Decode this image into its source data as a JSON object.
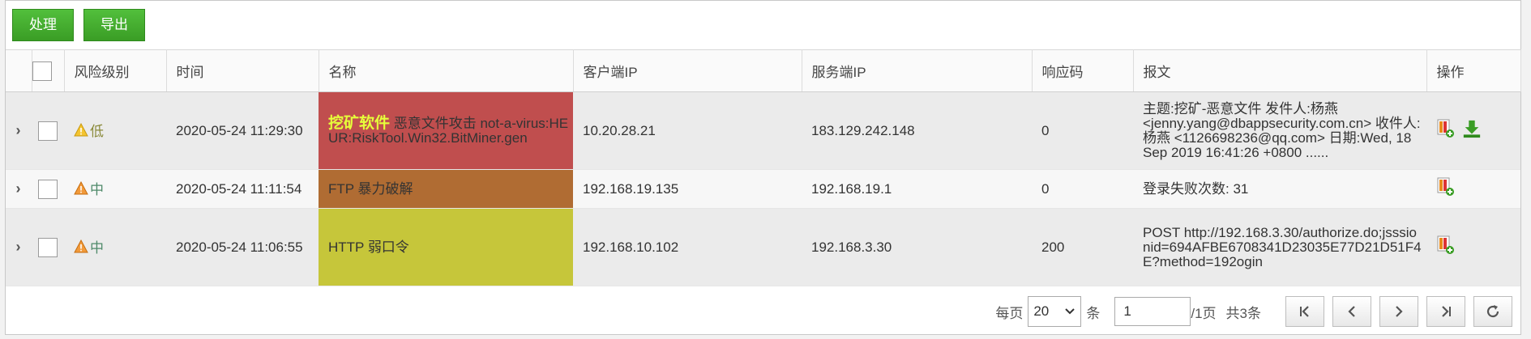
{
  "toolbar": {
    "process_label": "处理",
    "export_label": "导出"
  },
  "columns": {
    "risk": "风险级别",
    "time": "时间",
    "name": "名称",
    "client_ip": "客户端IP",
    "server_ip": "服务端IP",
    "code": "响应码",
    "message": "报文",
    "action": "操作"
  },
  "rows": [
    {
      "risk": "低",
      "time": "2020-05-24 11:29:30",
      "name_tag": "挖矿软件",
      "name_text": " 恶意文件攻击 ",
      "name_dark": "not-a-virus:HEUR:RiskTool.Win32.BitMiner.gen",
      "client_ip": "10.20.28.21",
      "server_ip": "183.129.242.148",
      "code": "0",
      "message": "主题:挖矿-恶意文件 发件人:杨燕 <jenny.yang@dbappsecurity.com.cn> 收件人:杨燕 <1126698236@qq.com> 日期:Wed, 18 Sep 2019 16:41:26 +0800 ......"
    },
    {
      "risk": "中",
      "time": "2020-05-24 11:11:54",
      "name_dark": "FTP ",
      "name_text": "暴力破解",
      "client_ip": "192.168.19.135",
      "server_ip": "192.168.19.1",
      "code": "0",
      "message": "登录失败次数: 31"
    },
    {
      "risk": "中",
      "time": "2020-05-24 11:06:55",
      "name_dark": "HTTP ",
      "name_text": "弱口令",
      "client_ip": "192.168.10.102",
      "server_ip": "192.168.3.30",
      "code": "200",
      "message": "POST http://192.168.3.30/authorize.do;jsssionid=694AFBE6708341D23035E77D21D51F4E?method=192ogin"
    }
  ],
  "pager": {
    "per_page_label": "每页",
    "per_page_value": "20",
    "unit_label": "条",
    "page_input": "1",
    "page_total": "/1页",
    "count_label": "共3条"
  },
  "icon_colors": {
    "green": "#3a9d25",
    "orange": "#e88a1a",
    "red": "#d33"
  }
}
